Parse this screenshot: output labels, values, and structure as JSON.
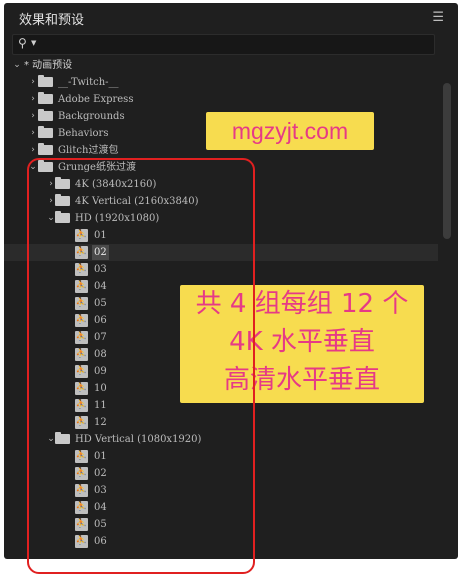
{
  "panel": {
    "title": "效果和预设",
    "menu_icon": "hamburger-menu-icon"
  },
  "search": {
    "value": "",
    "icon": "search-icon"
  },
  "tree": [
    {
      "label": "* 动画预设",
      "level": 0,
      "type": "root",
      "expanded": true
    },
    {
      "label": "__-Twitch-__",
      "level": 1,
      "type": "folder",
      "expanded": false
    },
    {
      "label": "Adobe Express",
      "level": 1,
      "type": "folder",
      "expanded": false
    },
    {
      "label": "Backgrounds",
      "level": 1,
      "type": "folder",
      "expanded": false
    },
    {
      "label": "Behaviors",
      "level": 1,
      "type": "folder",
      "expanded": false
    },
    {
      "label": "Glitch过渡包",
      "level": 1,
      "type": "folder",
      "expanded": false
    },
    {
      "label": "Grunge纸张过渡",
      "level": 1,
      "type": "folder",
      "expanded": true
    },
    {
      "label": "4K (3840x2160)",
      "level": 2,
      "type": "folder",
      "expanded": false
    },
    {
      "label": "4K Vertical (2160x3840)",
      "level": 2,
      "type": "folder",
      "expanded": false
    },
    {
      "label": "HD (1920x1080)",
      "level": 2,
      "type": "folder",
      "expanded": true
    },
    {
      "label": "01",
      "level": 3,
      "type": "preset"
    },
    {
      "label": "02",
      "level": 3,
      "type": "preset",
      "selected": true
    },
    {
      "label": "03",
      "level": 3,
      "type": "preset"
    },
    {
      "label": "04",
      "level": 3,
      "type": "preset"
    },
    {
      "label": "05",
      "level": 3,
      "type": "preset"
    },
    {
      "label": "06",
      "level": 3,
      "type": "preset"
    },
    {
      "label": "07",
      "level": 3,
      "type": "preset"
    },
    {
      "label": "08",
      "level": 3,
      "type": "preset"
    },
    {
      "label": "09",
      "level": 3,
      "type": "preset"
    },
    {
      "label": "10",
      "level": 3,
      "type": "preset"
    },
    {
      "label": "11",
      "level": 3,
      "type": "preset"
    },
    {
      "label": "12",
      "level": 3,
      "type": "preset"
    },
    {
      "label": "HD Vertical (1080x1920)",
      "level": 2,
      "type": "folder",
      "expanded": true
    },
    {
      "label": "01",
      "level": 3,
      "type": "preset"
    },
    {
      "label": "02",
      "level": 3,
      "type": "preset"
    },
    {
      "label": "03",
      "level": 3,
      "type": "preset"
    },
    {
      "label": "04",
      "level": 3,
      "type": "preset"
    },
    {
      "label": "05",
      "level": 3,
      "type": "preset"
    },
    {
      "label": "06",
      "level": 3,
      "type": "preset"
    }
  ],
  "watermark": {
    "text": "mgzyjt.com"
  },
  "annotation": {
    "lines": [
      "共 4 组每组 12 个",
      "4K 水平垂直",
      "高清水平垂直"
    ]
  },
  "colors": {
    "panel_bg": "#1f1f1f",
    "annotation_bg": "#f7dc4f",
    "annotation_text": "#e63a86",
    "outline_red": "#e02020"
  }
}
